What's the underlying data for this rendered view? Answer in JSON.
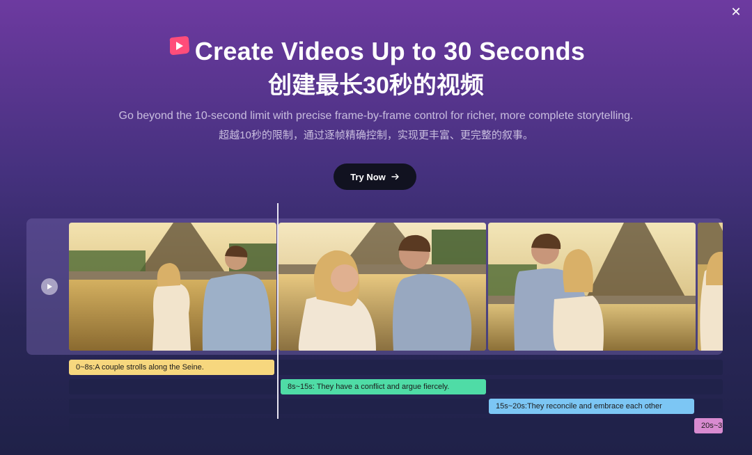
{
  "header": {
    "title_en": "Create Videos Up to 30 Seconds",
    "title_cn": "创建最长30秒的视频",
    "subtitle_en": "Go beyond the 10-second limit with precise frame-by-frame control for richer, more complete storytelling.",
    "subtitle_cn": "超越10秒的限制，通过逐帧精确控制，实现更丰富、更完整的叙事。"
  },
  "cta": {
    "label": "Try Now",
    "icon": "arrow-right-icon"
  },
  "close": {
    "icon": "close-icon",
    "glyph": "✕"
  },
  "timeline": {
    "play_icon": "play-icon",
    "frames": [
      "couple-walking-frame",
      "couple-arguing-frame",
      "couple-embracing-frame",
      "partial-frame"
    ],
    "clips": [
      {
        "label": "0~8s:A couple strolls along the Seine.",
        "color": "#f7d77e"
      },
      {
        "label": "8s~15s: They have a conflict and argue fiercely.",
        "color": "#4fdca6"
      },
      {
        "label": "15s~20s:They reconcile and embrace each other",
        "color": "#7cc6f4"
      },
      {
        "label": "20s~3",
        "color": "#d88bd0"
      }
    ]
  },
  "colors": {
    "accent_logo": "#ff4d7a",
    "cta_bg": "#111220"
  }
}
